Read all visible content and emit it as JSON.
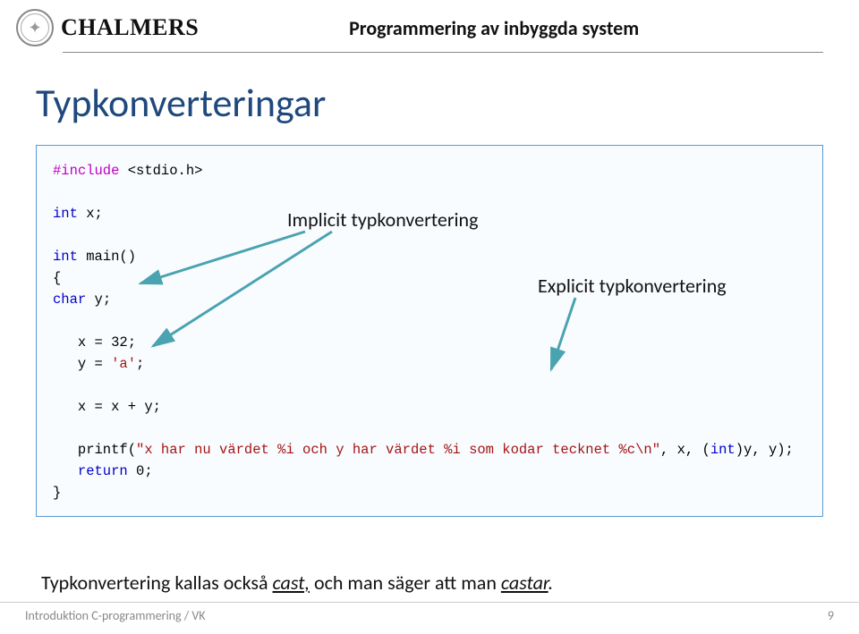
{
  "header": {
    "brand": "CHALMERS",
    "course": "Programmering av inbyggda system"
  },
  "slide": {
    "title": "Typkonverteringar"
  },
  "code": {
    "l1a": "#include",
    "l1b": " <stdio.h>",
    "l2a": "int",
    "l2b": " x;",
    "l3a": "int",
    "l3b": " main()",
    "l4": "{",
    "l5a": "char",
    "l5b": " y;",
    "l6a": "   x = 32;",
    "l7a": "   y = ",
    "l7b": "'a'",
    "l7c": ";",
    "l8": "   x = x + y;",
    "l9a": "   printf(",
    "l9b": "\"x har nu värdet %i och y har värdet %i som kodar tecknet %c\\n\"",
    "l9c": ", x, (",
    "l9d": "int",
    "l9e": ")y, y);",
    "l10a": "   return",
    "l10b": " 0;",
    "l11": "}"
  },
  "annot": {
    "implicit": "Implicit typkonvertering",
    "explicit": "Explicit typkonvertering"
  },
  "closing": {
    "pre": "Typkonvertering kallas också ",
    "cast": "cast,",
    "mid": " och man säger att man ",
    "castar": "castar",
    "dot": "."
  },
  "footer": {
    "left": "Introduktion C-programmering / VK",
    "page": "9"
  }
}
